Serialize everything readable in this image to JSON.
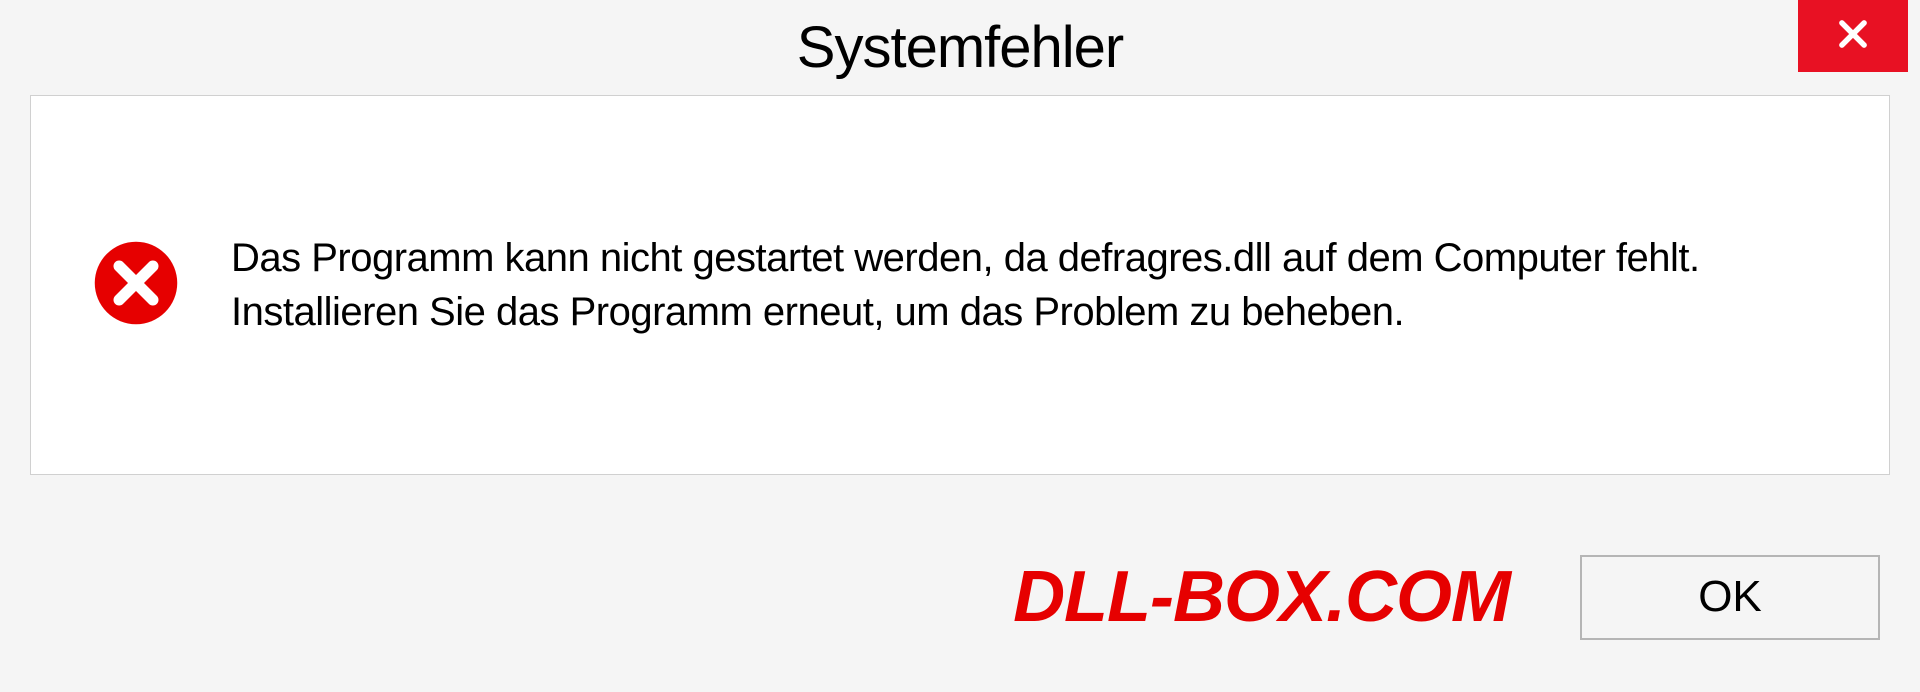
{
  "dialog": {
    "title": "Systemfehler",
    "message": "Das Programm kann nicht gestartet werden, da defragres.dll auf dem Computer fehlt. Installieren Sie das Programm erneut, um das Problem zu beheben.",
    "ok_label": "OK"
  },
  "watermark": "DLL-BOX.COM"
}
